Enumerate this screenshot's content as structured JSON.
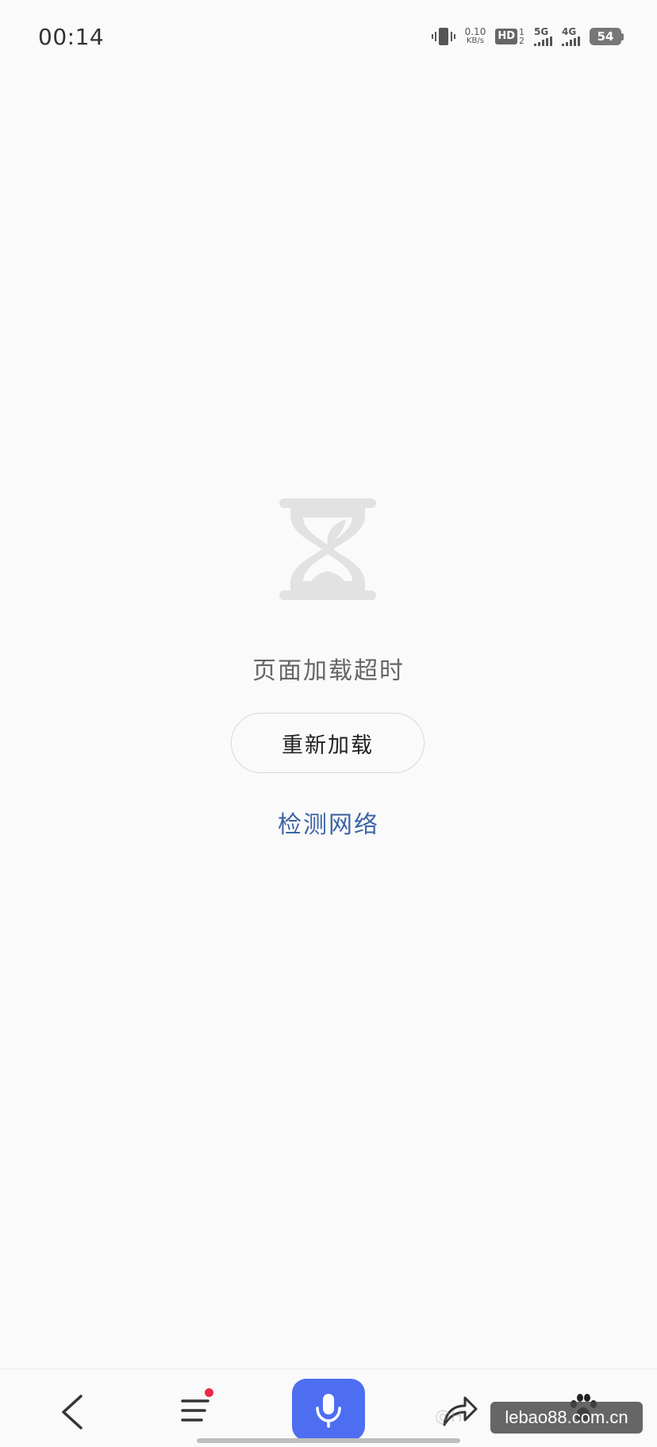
{
  "status_bar": {
    "time": "00:14",
    "net_speed_value": "0.10",
    "net_speed_unit": "KB/s",
    "hd_label": "HD",
    "hd_slot_top": "1",
    "hd_slot_bottom": "2",
    "signal_1_label": "5G",
    "signal_2_label": "4G",
    "battery_level": "54"
  },
  "error": {
    "icon": "hourglass-icon",
    "message": "页面加载超时",
    "reload_label": "重新加载",
    "check_network_label": "检测网络"
  },
  "bottom_nav": {
    "items": [
      {
        "icon": "back-arrow-icon"
      },
      {
        "icon": "menu-icon",
        "badge_color": "#f0284a"
      },
      {
        "icon": "microphone-icon",
        "color": "#4e6ef2"
      },
      {
        "icon": "share-icon"
      },
      {
        "icon": "paw-icon"
      }
    ]
  },
  "watermark": {
    "text": "lebao88.com.cn",
    "faint_text": "@H"
  },
  "colors": {
    "background": "#fafafa",
    "link": "#3c64a8",
    "accent": "#4e6ef2",
    "badge": "#f0284a"
  }
}
